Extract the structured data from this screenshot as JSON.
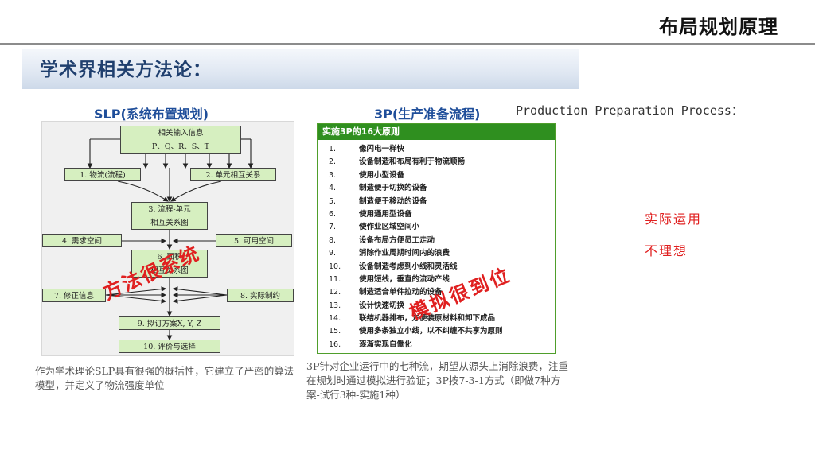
{
  "header": {
    "title": "布局规划原理"
  },
  "section": {
    "heading": "学术界相关方法论："
  },
  "slp": {
    "heading": "SLP(系统布置规划)",
    "boxes": {
      "input_line1": "相关输入信息",
      "input_line2": "P、Q、R、S、T",
      "flow": "1. 物流(流程)",
      "relation": "2. 单元相互关系",
      "chart_line1": "3. 流程-单元",
      "chart_line2": "相互关系图",
      "need": "4. 需求空间",
      "avail": "5. 可用空间",
      "area_line1": "6. 面积",
      "area_line2": "相互关系图",
      "modify": "7. 修正信息",
      "limits": "8. 实际制约",
      "plan": "9. 拟订方案X, Y, Z",
      "eval": "10. 评价与选择"
    },
    "caption": "作为学术理论SLP具有很强的概括性，它建立了严密的算法模型，并定义了物流强度单位",
    "stamp": "方法很系统"
  },
  "tp": {
    "heading": "3P(生产准备流程)",
    "subheading": "Production Preparation Process：",
    "panel_title": "实施3P的16大原则",
    "principles": [
      {
        "num": "1.",
        "text": "像闪电一样快"
      },
      {
        "num": "2.",
        "text": "设备制造和布局有利于物流顺畅"
      },
      {
        "num": "3.",
        "text": "使用小型设备"
      },
      {
        "num": "4.",
        "text": "制造便于切换的设备"
      },
      {
        "num": "5.",
        "text": "制造便于移动的设备"
      },
      {
        "num": "6.",
        "text": "使用通用型设备"
      },
      {
        "num": "7.",
        "text": "使作业区域空间小"
      },
      {
        "num": "8.",
        "text": "设备布局方便员工走动"
      },
      {
        "num": "9.",
        "text": "消除作业周期时间内的浪费"
      },
      {
        "num": "10.",
        "text": "设备制造考虑到小线和灵活线"
      },
      {
        "num": "11.",
        "text": "使用短线，垂直的流动产线"
      },
      {
        "num": "12.",
        "text": "制造适合单件拉动的设备"
      },
      {
        "num": "13.",
        "text": "设计快速切换"
      },
      {
        "num": "14.",
        "text": "联结机器排布，方便装原材料和卸下成品"
      },
      {
        "num": "15.",
        "text": "使用多条独立小线，以不纠缠不共享为原则"
      },
      {
        "num": "16.",
        "text": "逐渐实现自働化"
      }
    ],
    "caption": "3P针对企业运行中的七种流，期望从源头上消除浪费，注重在规划时通过模拟进行验证；3P按7-3-1方式（即做7种方案-试行3种-实施1种）",
    "stamp": "模拟很到位"
  },
  "side_note": {
    "line1": "实际运用",
    "line2": "不理想"
  },
  "colors": {
    "stamp_red": "#e02020",
    "heading_blue": "#1f4e9a",
    "panel_green": "#2f8f1f",
    "box_green": "#d6efc0"
  }
}
